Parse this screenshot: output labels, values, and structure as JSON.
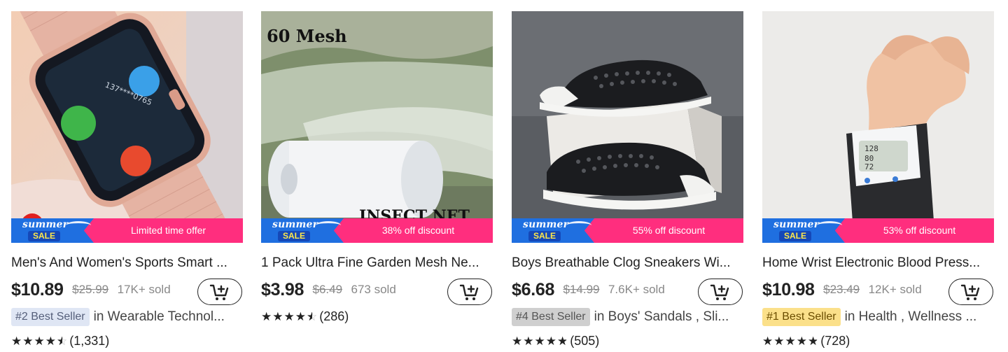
{
  "products": [
    {
      "image_text": "",
      "promo": {
        "summer": "summer",
        "sale": "SALE",
        "offer": "Limited time offer"
      },
      "title": "Men's And Women's Sports Smart ...",
      "price": "$10.89",
      "original_price": "$25.99",
      "sold": "17K+ sold",
      "best_seller": {
        "badge": "#2 Best Seller",
        "category": "in Wearable Technol...",
        "badge_bg": "#dfe6f4",
        "badge_color": "#555f7a"
      },
      "rating": {
        "stars": 4.5,
        "count": "(1,331)"
      }
    },
    {
      "image_text": "60 Mesh",
      "image_text_2": "INSECT NET",
      "promo": {
        "summer": "summer",
        "sale": "SALE",
        "offer": "38% off discount"
      },
      "title": "1 Pack Ultra Fine Garden Mesh Ne...",
      "price": "$3.98",
      "original_price": "$6.49",
      "sold": "673 sold",
      "best_seller": null,
      "rating": {
        "stars": 4.5,
        "count": "(286)"
      }
    },
    {
      "image_text": "",
      "promo": {
        "summer": "summer",
        "sale": "SALE",
        "offer": "55% off discount"
      },
      "title": "Boys Breathable Clog Sneakers Wi...",
      "price": "$6.68",
      "original_price": "$14.99",
      "sold": "7.6K+ sold",
      "best_seller": {
        "badge": "#4 Best Seller",
        "category": "in Boys' Sandals , Sli...",
        "badge_bg": "#cfcfcf",
        "badge_color": "#555"
      },
      "rating": {
        "stars": 4.8,
        "count": "(505)"
      }
    },
    {
      "image_text": "",
      "promo": {
        "summer": "summer",
        "sale": "SALE",
        "offer": "53% off discount"
      },
      "title": "Home Wrist Electronic Blood Press...",
      "price": "$10.98",
      "original_price": "$23.49",
      "sold": "12K+ sold",
      "best_seller": {
        "badge": "#1 Best Seller",
        "category": "in Health , Wellness ...",
        "badge_bg": "#fbe08a",
        "badge_color": "#6b4d00"
      },
      "rating": {
        "stars": 4.8,
        "count": "(728)"
      }
    }
  ],
  "icons": {
    "cart": "add-to-cart-icon",
    "star": "star-icon"
  },
  "colors": {
    "promo_pink": "#ff2e7e",
    "promo_blue": "#1f6fe0"
  }
}
